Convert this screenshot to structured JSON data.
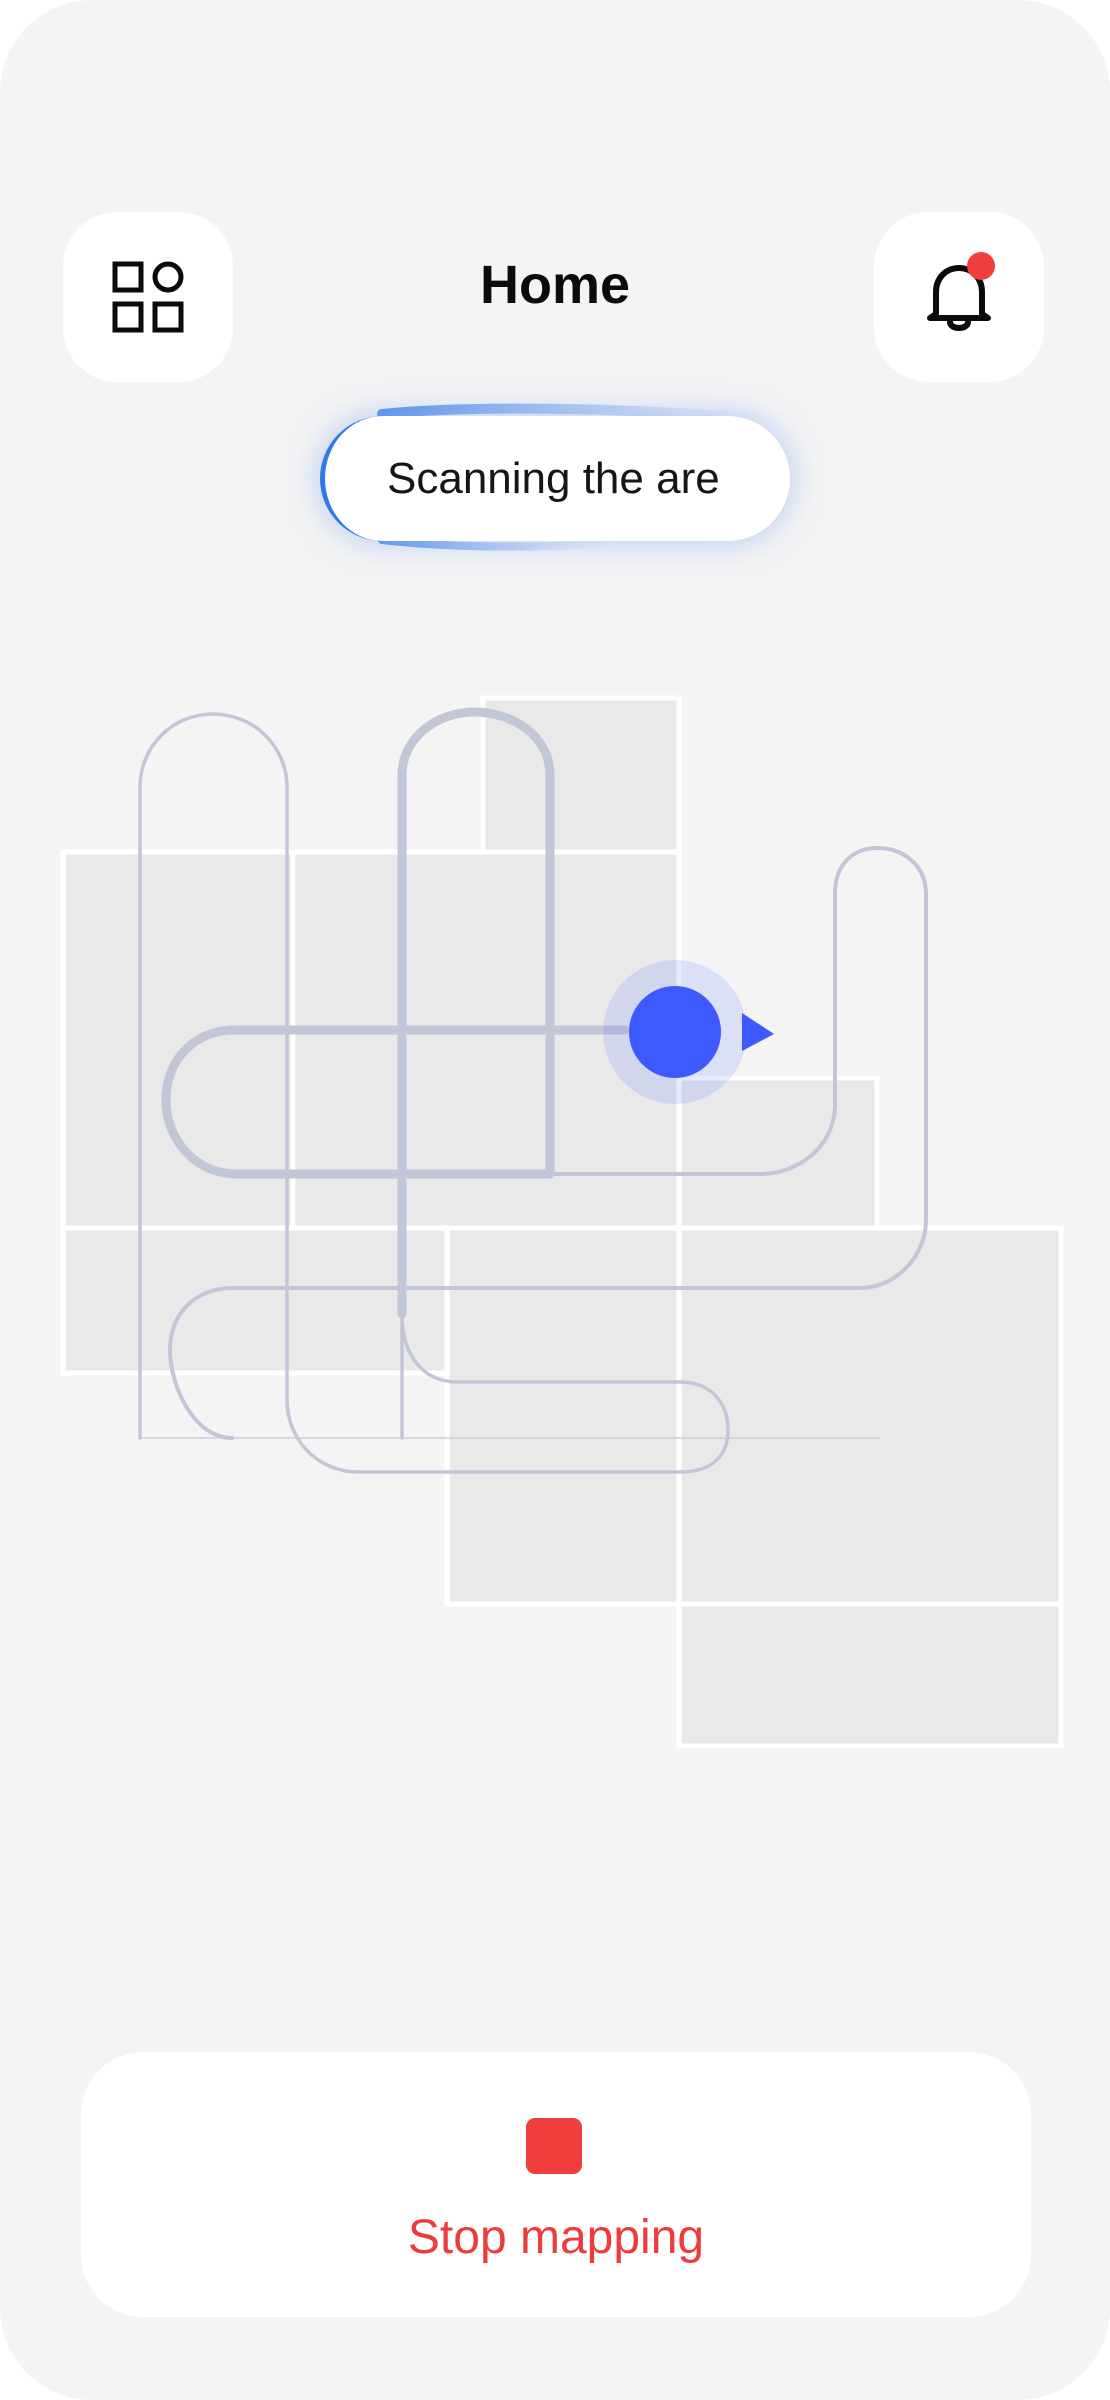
{
  "header": {
    "title": "Home",
    "menu_icon": "grid-apps-icon",
    "notification_icon": "bell-icon",
    "notification_badge_color": "#f03e3e"
  },
  "status": {
    "text": "Scanning the are",
    "accent_color": "#2f7ae5"
  },
  "map": {
    "robot_color": "#3d5afe",
    "path_color": "#c3c6d6",
    "room_fill": "#e9e9ea"
  },
  "action": {
    "stop_label": "Stop mapping",
    "stop_icon": "stop-square-icon",
    "color": "#ef3b3b"
  }
}
